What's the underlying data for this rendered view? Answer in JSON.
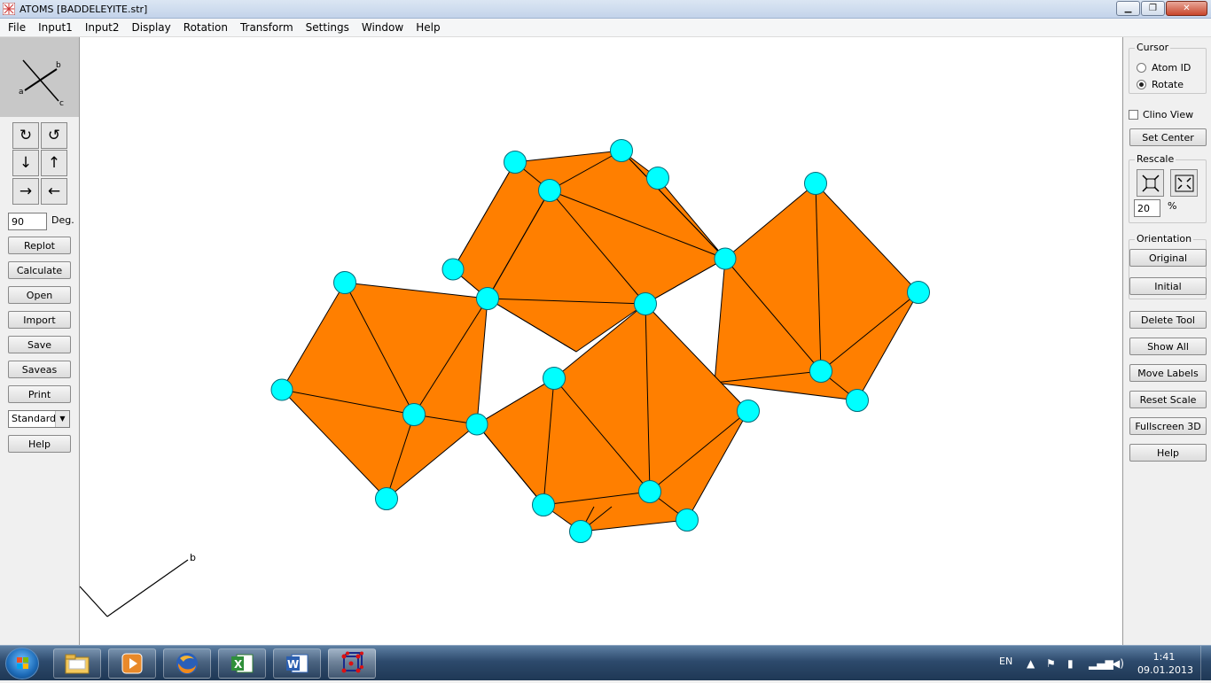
{
  "window": {
    "title": "ATOMS [BADDELEYITE.str]"
  },
  "menu": [
    "File",
    "Input1",
    "Input2",
    "Display",
    "Rotation",
    "Transform",
    "Settings",
    "Window",
    "Help"
  ],
  "left": {
    "axes": {
      "a": "a",
      "b": "b",
      "c": "c"
    },
    "rotation_buttons": [
      "rotate-cw-icon",
      "rotate-ccw-icon",
      "arrow-down-icon",
      "arrow-up-icon",
      "arrow-right-icon",
      "arrow-left-icon"
    ],
    "degrees_value": "90",
    "degrees_label": "Deg.",
    "buttons": [
      "Replot",
      "Calculate",
      "Open",
      "Import",
      "Save",
      "Saveas",
      "Print"
    ],
    "style_select": "Standard",
    "help": "Help"
  },
  "canvas": {
    "axis_label": "b"
  },
  "right": {
    "cursor_group": "Cursor",
    "cursor_options": [
      "Atom ID",
      "Rotate"
    ],
    "cursor_selected": "Rotate",
    "clino_view": "Clino View",
    "set_center": "Set Center",
    "rescale_group": "Rescale",
    "rescale_value": "20",
    "rescale_unit": "%",
    "orientation_group": "Orientation",
    "orientation_buttons": [
      "Original",
      "Initial"
    ],
    "buttons": [
      "Delete Tool",
      "Show All",
      "Move Labels",
      "Reset Scale",
      "Fullscreen 3D",
      "Help"
    ]
  },
  "taskbar": {
    "apps": [
      "explorer-icon",
      "media-player-icon",
      "firefox-icon",
      "excel-icon",
      "word-icon",
      "atoms-icon"
    ],
    "lang": "EN",
    "time": "1:41",
    "date": "09.01.2013"
  },
  "colors": {
    "polyhedron": "#ff7f00",
    "atom": "#00ffff",
    "canvas": "#ffffff"
  }
}
